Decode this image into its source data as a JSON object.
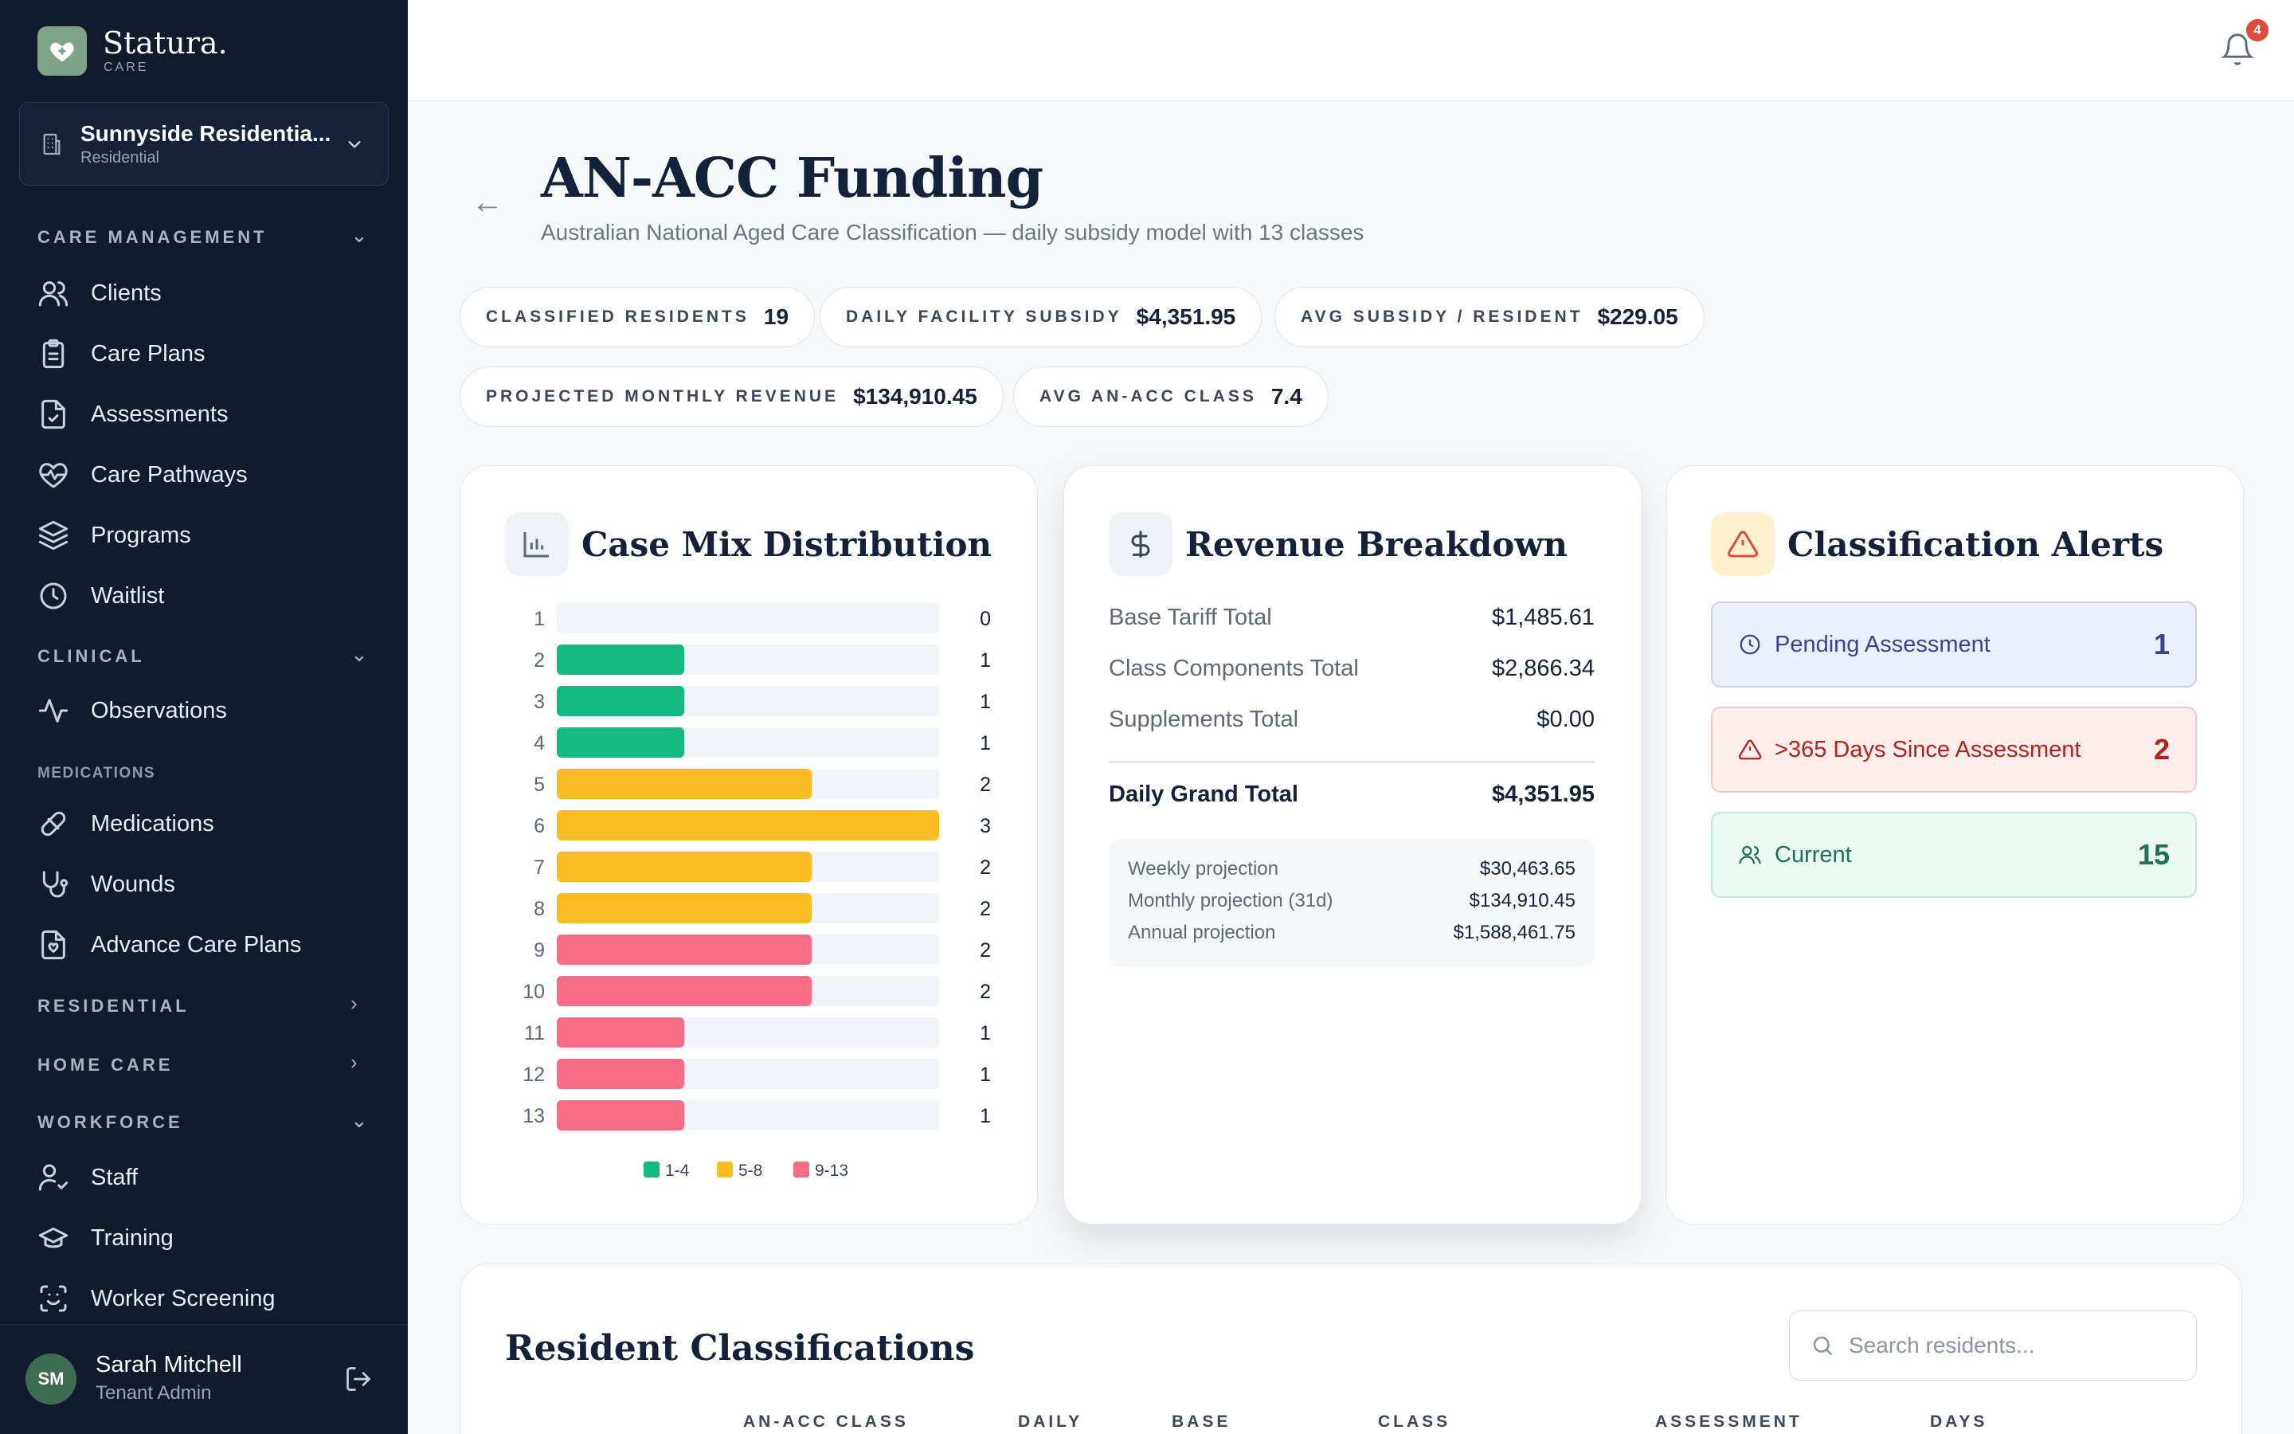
{
  "app": {
    "name": "Statura.",
    "sub": "CARE"
  },
  "facility": {
    "name": "Sunnyside Residentia...",
    "type": "Residential"
  },
  "sidebar": {
    "care_management": "CARE MANAGEMENT",
    "clinical": "CLINICAL",
    "medications_section": "MEDICATIONS",
    "residential": "RESIDENTIAL",
    "home_care": "HOME CARE",
    "workforce": "WORKFORCE",
    "items": {
      "clients": "Clients",
      "care_plans": "Care Plans",
      "assessments": "Assessments",
      "care_pathways": "Care Pathways",
      "programs": "Programs",
      "waitlist": "Waitlist",
      "observations": "Observations",
      "medications": "Medications",
      "wounds": "Wounds",
      "advance_care_plans": "Advance Care Plans",
      "staff": "Staff",
      "training": "Training",
      "worker_screening": "Worker Screening"
    }
  },
  "user": {
    "initials": "SM",
    "name": "Sarah Mitchell",
    "role": "Tenant Admin"
  },
  "notifications": {
    "count": "4"
  },
  "page": {
    "title": "AN-ACC Funding",
    "subtitle": "Australian National Aged Care Classification — daily subsidy model with 13 classes"
  },
  "stats": [
    {
      "label": "CLASSIFIED RESIDENTS",
      "value": "19"
    },
    {
      "label": "DAILY FACILITY SUBSIDY",
      "value": "$4,351.95"
    },
    {
      "label": "AVG SUBSIDY / RESIDENT",
      "value": "$229.05"
    },
    {
      "label": "PROJECTED MONTHLY REVENUE",
      "value": "$134,910.45"
    },
    {
      "label": "AVG AN-ACC CLASS",
      "value": "7.4"
    }
  ],
  "case_mix": {
    "title": "Case Mix Distribution"
  },
  "chart_data": {
    "type": "bar",
    "orientation": "horizontal",
    "categories": [
      "1",
      "2",
      "3",
      "4",
      "5",
      "6",
      "7",
      "8",
      "9",
      "10",
      "11",
      "12",
      "13"
    ],
    "values": [
      0,
      1,
      1,
      1,
      2,
      3,
      2,
      2,
      2,
      2,
      1,
      1,
      1
    ],
    "xlim": [
      0,
      3
    ],
    "groups": [
      {
        "name": "1-4",
        "color": "#14b881",
        "classes": [
          "1",
          "2",
          "3",
          "4"
        ]
      },
      {
        "name": "5-8",
        "color": "#fbbd23",
        "classes": [
          "5",
          "6",
          "7",
          "8"
        ]
      },
      {
        "name": "9-13",
        "color": "#f76b85",
        "classes": [
          "9",
          "10",
          "11",
          "12",
          "13"
        ]
      }
    ],
    "legend": "bottom"
  },
  "revenue": {
    "title": "Revenue Breakdown",
    "rows": [
      {
        "label": "Base Tariff Total",
        "value": "$1,485.61"
      },
      {
        "label": "Class Components Total",
        "value": "$2,866.34"
      },
      {
        "label": "Supplements Total",
        "value": "$0.00"
      }
    ],
    "grand": {
      "label": "Daily Grand Total",
      "value": "$4,351.95"
    },
    "projections": [
      {
        "label": "Weekly projection",
        "value": "$30,463.65"
      },
      {
        "label": "Monthly projection (31d)",
        "value": "$134,910.45"
      },
      {
        "label": "Annual projection",
        "value": "$1,588,461.75"
      }
    ]
  },
  "alerts": {
    "title": "Classification Alerts",
    "items": [
      {
        "label": "Pending Assessment",
        "count": "1",
        "color": "#3b3f99",
        "bg": "#eceffd",
        "border": "#c9d0f2"
      },
      {
        "label": ">365 Days Since Assessment",
        "count": "2",
        "color": "#b42318",
        "bg": "#fdeeed",
        "border": "#f6c9c4"
      },
      {
        "label": "Current",
        "count": "15",
        "color": "#1f6f55",
        "bg": "#e9f8f1",
        "border": "#bfe8d6"
      }
    ]
  },
  "table": {
    "title": "Resident Classifications",
    "search_placeholder": "Search residents...",
    "columns": [
      "AN-ACC CLASS",
      "DAILY",
      "BASE",
      "CLASS",
      "ASSESSMENT",
      "DAYS"
    ]
  },
  "colors": {
    "sidebar": "#111b2e",
    "accent": "#7ea487",
    "danger": "#e04a3a"
  }
}
